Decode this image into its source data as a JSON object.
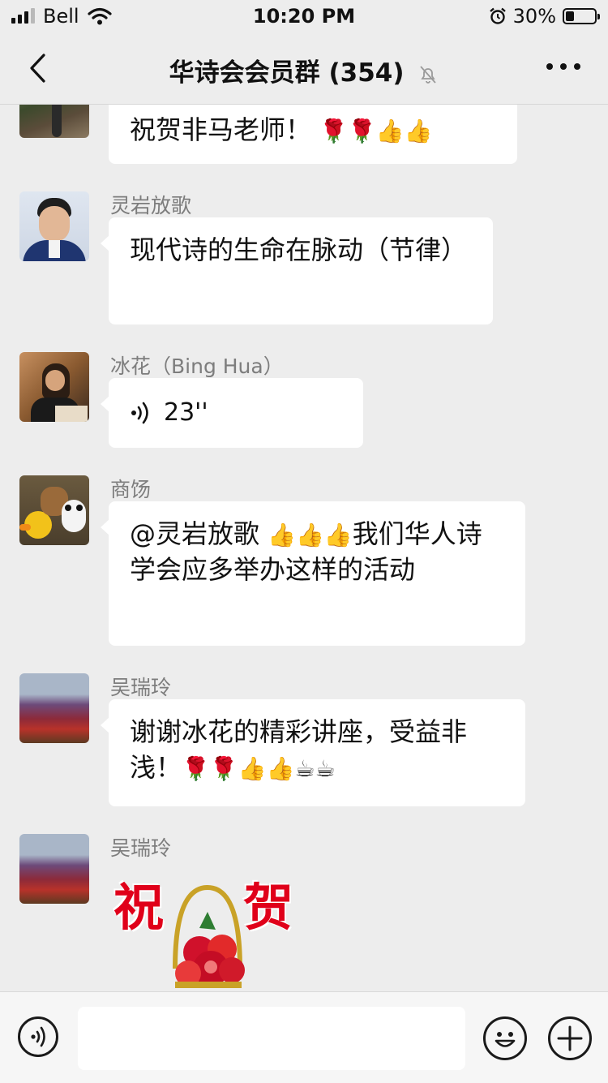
{
  "status_bar": {
    "carrier": "Bell",
    "time": "10:20 PM",
    "battery_percent": "30%",
    "battery_level": 0.3
  },
  "nav": {
    "title": "华诗会会员群 (354)",
    "back_icon": "chevron-left-icon",
    "mute_icon": "bell-muted-icon",
    "more_icon": "more-dots-icon"
  },
  "messages": [
    {
      "sender": "",
      "text": "祝贺非马老师！",
      "emojis": "🌹🌹👍👍"
    },
    {
      "sender": "灵岩放歌",
      "text": "现代诗的生命在脉动（节律）"
    },
    {
      "sender": "冰花（Bing Hua）",
      "voice_duration": "23''"
    },
    {
      "sender": "商饧",
      "text_before": "@灵岩放歌 ",
      "emojis": "👍👍👍",
      "text_after": "我们华人诗学会应多举办这样的活动"
    },
    {
      "sender": "吴瑞玲",
      "text": "谢谢冰花的精彩讲座，受益非浅！",
      "emojis": "🌹🌹👍👍☕☕"
    },
    {
      "sender": "吴瑞玲",
      "sticker_text": [
        "祝",
        "贺"
      ]
    }
  ],
  "input_bar": {
    "voice_icon": "voice-mode-icon",
    "emoji_icon": "emoji-face-icon",
    "plus_icon": "plus-icon",
    "placeholder": ""
  }
}
